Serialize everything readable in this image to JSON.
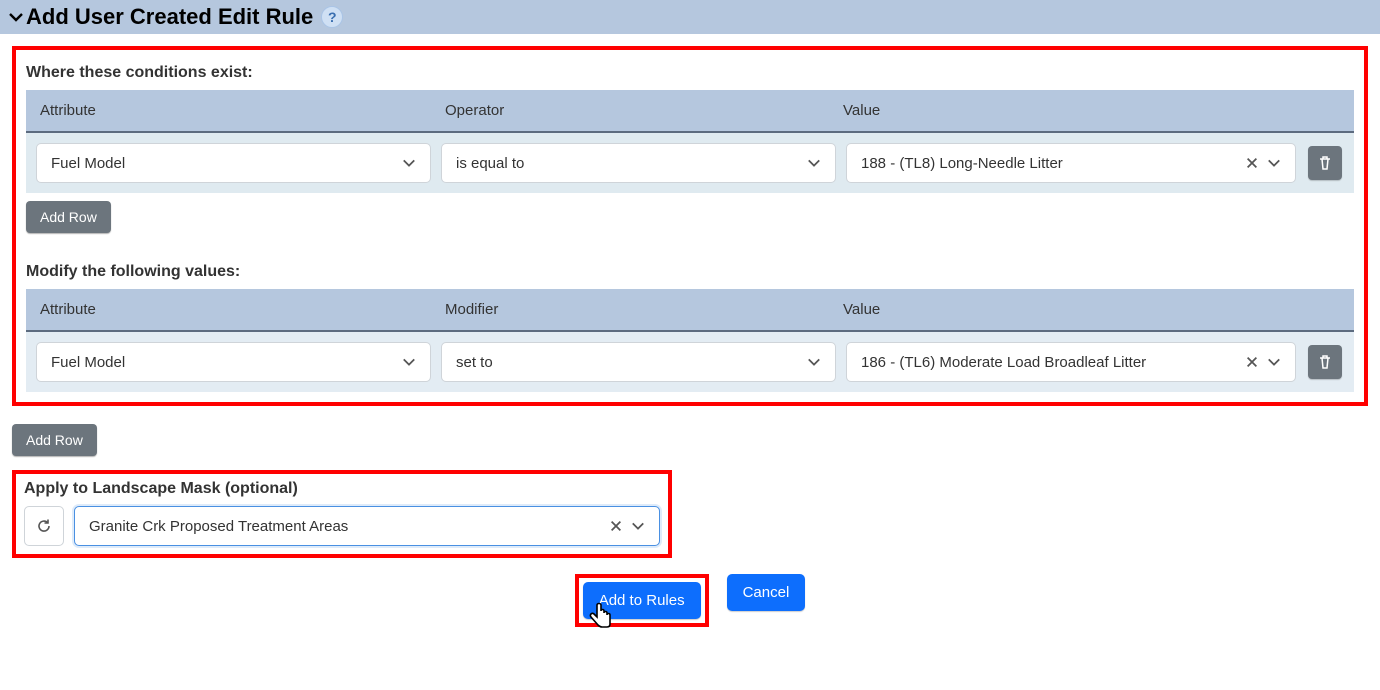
{
  "header": {
    "title": "Add User Created Edit Rule"
  },
  "conditions_section": {
    "heading": "Where these conditions exist:",
    "columns": {
      "attribute": "Attribute",
      "operator": "Operator",
      "value": "Value"
    },
    "rows": [
      {
        "attribute": "Fuel Model",
        "operator": "is equal to",
        "value": "188 - (TL8) Long-Needle Litter"
      }
    ],
    "add_row_label": "Add Row"
  },
  "modifications_section": {
    "heading": "Modify the following values:",
    "columns": {
      "attribute": "Attribute",
      "modifier": "Modifier",
      "value": "Value"
    },
    "rows": [
      {
        "attribute": "Fuel Model",
        "modifier": "set to",
        "value": "186 - (TL6) Moderate Load Broadleaf Litter"
      }
    ],
    "add_row_label": "Add Row"
  },
  "mask_section": {
    "heading": "Apply to Landscape Mask (optional)",
    "value": "Granite Crk Proposed Treatment Areas"
  },
  "actions": {
    "add_to_rules": "Add to Rules",
    "cancel": "Cancel"
  }
}
